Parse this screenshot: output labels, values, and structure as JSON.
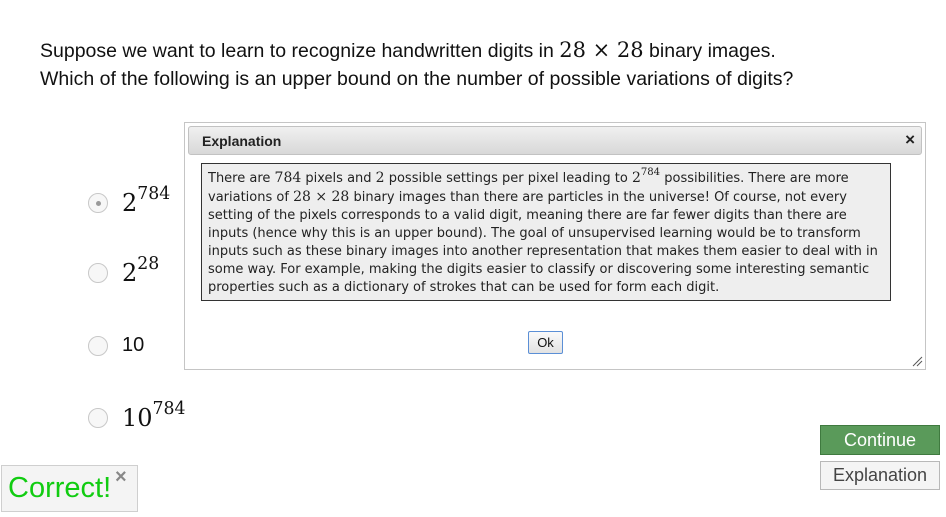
{
  "question": {
    "line1_prefix": "Suppose we want to learn to recognize handwritten digits in ",
    "line1_math": "28 × 28",
    "line1_suffix": " binary images.",
    "line2": "Which of the following is an upper bound on the number of possible variations of digits?"
  },
  "choices": [
    {
      "base": "2",
      "exponent": "784",
      "selected": true
    },
    {
      "base": "2",
      "exponent": "28",
      "selected": false
    },
    {
      "base": "10",
      "exponent": "",
      "selected": false
    },
    {
      "base": "10",
      "exponent": "784",
      "selected": false
    }
  ],
  "dialog": {
    "title": "Explanation",
    "close_symbol": "×",
    "body": {
      "t1": "There are ",
      "m1": "784",
      "t2": " pixels and ",
      "m2": "2",
      "t3": " possible settings per pixel leading to ",
      "m3_base": "2",
      "m3_exp": "784",
      "t4": " possibilities. There are more variations of ",
      "m4": "28 × 28",
      "t5": " binary images than there are particles in the universe! Of course, not every setting of the pixels corresponds to a valid digit, meaning there are far fewer digits than there are inputs (hence why this is an upper bound). The goal of unsupervised learning would be to transform inputs such as these binary images into another representation that makes them easier to deal with in some way. For example, making the digits easier to classify or discovering some interesting semantic properties such as a dictionary of strokes that can be used for form each digit."
    },
    "ok_label": "Ok"
  },
  "buttons": {
    "continue_label": "Continue",
    "explanation_label": "Explanation"
  },
  "feedback": {
    "text": "Correct!",
    "close_symbol": "×"
  },
  "colors": {
    "correct_green": "#11cc11",
    "continue_bg": "#5a9a5a"
  }
}
